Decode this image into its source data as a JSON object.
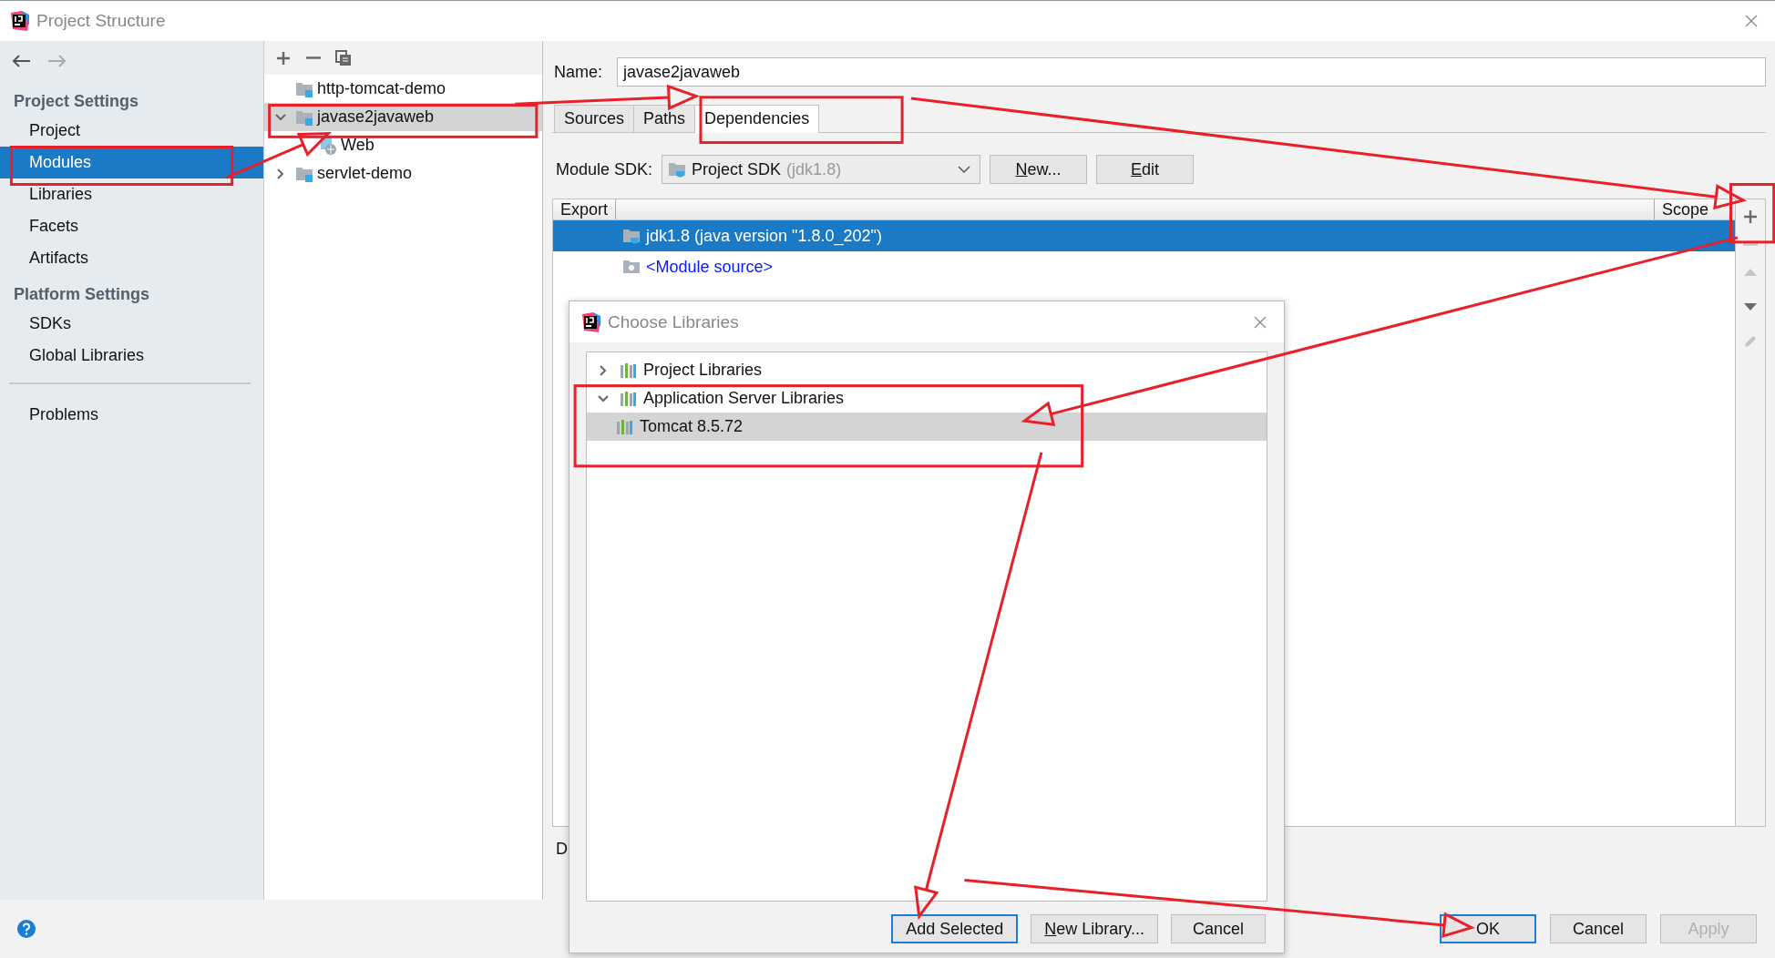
{
  "window": {
    "title": "Project Structure"
  },
  "nav": {
    "sections": [
      {
        "heading": "Project Settings",
        "items": [
          {
            "label": "Project",
            "selected": false
          },
          {
            "label": "Modules",
            "selected": true
          },
          {
            "label": "Libraries",
            "selected": false
          },
          {
            "label": "Facets",
            "selected": false
          },
          {
            "label": "Artifacts",
            "selected": false
          }
        ]
      },
      {
        "heading": "Platform Settings",
        "items": [
          {
            "label": "SDKs",
            "selected": false
          },
          {
            "label": "Global Libraries",
            "selected": false
          }
        ]
      }
    ],
    "footer_items": [
      {
        "label": "Problems",
        "selected": false
      }
    ]
  },
  "module_tree": {
    "items": [
      {
        "label": "http-tomcat-demo",
        "kind": "module",
        "has_children": false,
        "selected": false
      },
      {
        "label": "javase2javaweb",
        "kind": "module",
        "has_children": true,
        "expanded": true,
        "selected": true,
        "children": [
          {
            "label": "Web",
            "kind": "web",
            "has_children": false,
            "selected": false
          }
        ]
      },
      {
        "label": "servlet-demo",
        "kind": "module",
        "has_children": true,
        "expanded": false,
        "selected": false
      }
    ]
  },
  "module": {
    "name_label": "Name:",
    "name_value": "javase2javaweb",
    "tabs": [
      {
        "label": "Sources",
        "selected": false
      },
      {
        "label": "Paths",
        "selected": false
      },
      {
        "label": "Dependencies",
        "selected": true
      }
    ],
    "sdk_label": "Module SDK:",
    "sdk_value": "Project SDK",
    "sdk_hint": "(jdk1.8)",
    "sdk_buttons": [
      {
        "label": "New...",
        "mnemonic": true
      },
      {
        "label": "Edit",
        "mnemonic": true
      }
    ],
    "table": {
      "columns": [
        "Export",
        "Scope"
      ],
      "rows": [
        {
          "name": "jdk1.8 (java version \"1.8.0_202\")",
          "kind": "sdk",
          "selected": true
        },
        {
          "name": "<Module source>",
          "kind": "source",
          "selected": false
        }
      ]
    },
    "side_tools": [
      {
        "kind": "add",
        "disabled": false
      },
      {
        "kind": "remove",
        "disabled": true
      },
      {
        "kind": "up",
        "disabled": true
      },
      {
        "kind": "down",
        "disabled": false
      },
      {
        "kind": "edit",
        "disabled": true
      }
    ],
    "below_table": "D"
  },
  "footer": {
    "buttons": [
      {
        "label": "OK",
        "default": true,
        "disabled": false
      },
      {
        "label": "Cancel",
        "default": false,
        "disabled": false
      },
      {
        "label": "Apply",
        "default": false,
        "disabled": true
      }
    ]
  },
  "dialog": {
    "title": "Choose Libraries",
    "tree": [
      {
        "label": "Project Libraries",
        "expanded": false,
        "selected": false
      },
      {
        "label": "Application Server Libraries",
        "expanded": true,
        "selected": false,
        "children": [
          {
            "label": "Tomcat 8.5.72",
            "selected": true
          }
        ]
      }
    ],
    "buttons": [
      {
        "label": "Add Selected",
        "default": true,
        "mnemonic": false
      },
      {
        "label": "New Library...",
        "default": false,
        "mnemonic": true
      },
      {
        "label": "Cancel",
        "default": false,
        "mnemonic": false
      }
    ]
  }
}
